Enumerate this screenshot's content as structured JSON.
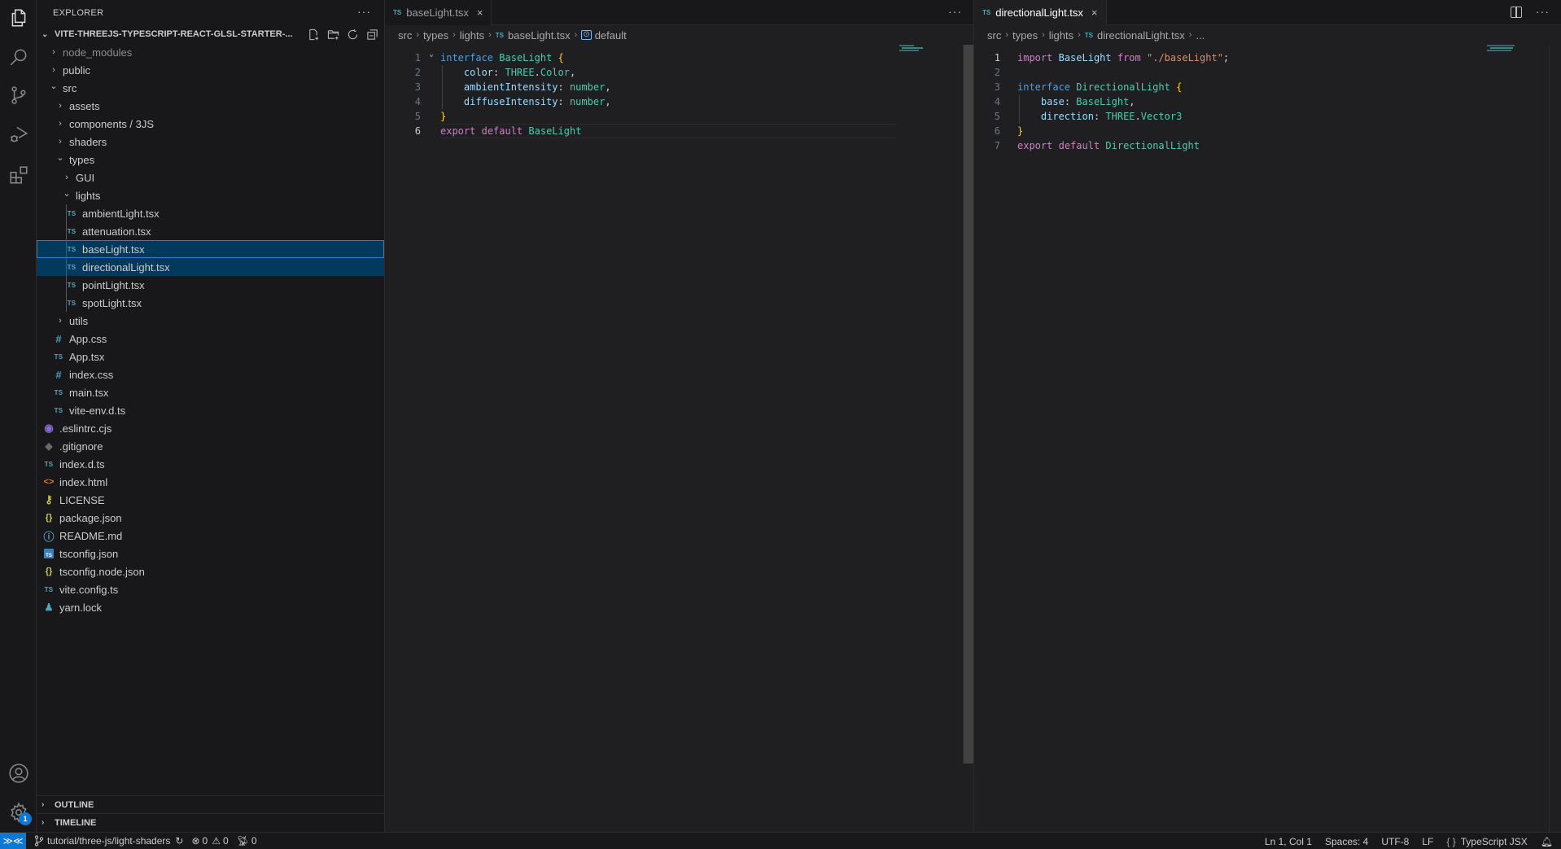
{
  "sidebar": {
    "title": "EXPLORER",
    "more_label": "···",
    "root": "VITE-THREEJS-TYPESCRIPT-REACT-GLSL-STARTER-...",
    "tree": [
      {
        "label": "node_modules",
        "type": "folder",
        "depth": 0,
        "expanded": false,
        "dim": true
      },
      {
        "label": "public",
        "type": "folder",
        "depth": 0,
        "expanded": false
      },
      {
        "label": "src",
        "type": "folder",
        "depth": 0,
        "expanded": true
      },
      {
        "label": "assets",
        "type": "folder",
        "depth": 1,
        "expanded": false
      },
      {
        "label": "components / 3JS",
        "type": "folder",
        "depth": 1,
        "expanded": false
      },
      {
        "label": "shaders",
        "type": "folder",
        "depth": 1,
        "expanded": false
      },
      {
        "label": "types",
        "type": "folder",
        "depth": 1,
        "expanded": true
      },
      {
        "label": "GUI",
        "type": "folder",
        "depth": 2,
        "expanded": false
      },
      {
        "label": "lights",
        "type": "folder",
        "depth": 2,
        "expanded": true
      },
      {
        "label": "ambientLight.tsx",
        "type": "ts",
        "depth": 3
      },
      {
        "label": "attenuation.tsx",
        "type": "ts",
        "depth": 3
      },
      {
        "label": "baseLight.tsx",
        "type": "ts",
        "depth": 3,
        "state": "focused"
      },
      {
        "label": "directionalLight.tsx",
        "type": "ts",
        "depth": 3,
        "state": "selected"
      },
      {
        "label": "pointLight.tsx",
        "type": "ts",
        "depth": 3
      },
      {
        "label": "spotLight.tsx",
        "type": "ts",
        "depth": 3
      },
      {
        "label": "utils",
        "type": "folder",
        "depth": 1,
        "expanded": false
      },
      {
        "label": "App.css",
        "type": "css",
        "depth": 1
      },
      {
        "label": "App.tsx",
        "type": "ts",
        "depth": 1
      },
      {
        "label": "index.css",
        "type": "css",
        "depth": 1
      },
      {
        "label": "main.tsx",
        "type": "ts",
        "depth": 1
      },
      {
        "label": "vite-env.d.ts",
        "type": "ts",
        "depth": 1
      },
      {
        "label": ".eslintrc.cjs",
        "type": "eslint",
        "depth": 0
      },
      {
        "label": ".gitignore",
        "type": "git",
        "depth": 0
      },
      {
        "label": "index.d.ts",
        "type": "ts",
        "depth": 0
      },
      {
        "label": "index.html",
        "type": "html",
        "depth": 0
      },
      {
        "label": "LICENSE",
        "type": "license",
        "depth": 0
      },
      {
        "label": "package.json",
        "type": "json",
        "depth": 0
      },
      {
        "label": "README.md",
        "type": "info",
        "depth": 0
      },
      {
        "label": "tsconfig.json",
        "type": "tsconfig",
        "depth": 0
      },
      {
        "label": "tsconfig.node.json",
        "type": "json",
        "depth": 0
      },
      {
        "label": "vite.config.ts",
        "type": "ts",
        "depth": 0
      },
      {
        "label": "yarn.lock",
        "type": "yarn",
        "depth": 0
      }
    ],
    "outline_label": "OUTLINE",
    "timeline_label": "TIMELINE"
  },
  "activity_bar": {
    "items": [
      "explorer-icon",
      "search-icon",
      "source-control-icon",
      "run-debug-icon",
      "extensions-icon"
    ],
    "bottom": [
      "account-icon",
      "settings-gear-icon"
    ],
    "settings_badge": "1"
  },
  "editors": [
    {
      "tab": {
        "icon": "TS",
        "label": "baseLight.tsx",
        "close": "×",
        "active": false
      },
      "breadcrumb": [
        "src",
        "types",
        "lights",
        "baseLight.tsx",
        "default"
      ],
      "more_label": "···",
      "current_line": 6,
      "lines": [
        {
          "n": "1",
          "fold": true,
          "tokens": [
            [
              "k",
              "interface"
            ],
            [
              "w",
              " "
            ],
            [
              "t",
              "BaseLight"
            ],
            [
              "w",
              " "
            ],
            [
              "b",
              "{"
            ]
          ]
        },
        {
          "n": "2",
          "tokens": [
            [
              "w",
              "    "
            ],
            [
              "p",
              "color"
            ],
            [
              "w",
              ": "
            ],
            [
              "t",
              "THREE"
            ],
            [
              "w",
              "."
            ],
            [
              "t",
              "Color"
            ],
            [
              "w",
              ","
            ]
          ]
        },
        {
          "n": "3",
          "tokens": [
            [
              "w",
              "    "
            ],
            [
              "p",
              "ambientIntensity"
            ],
            [
              "w",
              ": "
            ],
            [
              "t",
              "number"
            ],
            [
              "w",
              ","
            ]
          ]
        },
        {
          "n": "4",
          "tokens": [
            [
              "w",
              "    "
            ],
            [
              "p",
              "diffuseIntensity"
            ],
            [
              "w",
              ": "
            ],
            [
              "t",
              "number"
            ],
            [
              "w",
              ","
            ]
          ]
        },
        {
          "n": "5",
          "tokens": [
            [
              "b",
              "}"
            ]
          ]
        },
        {
          "n": "6",
          "tokens": [
            [
              "k2",
              "export"
            ],
            [
              "w",
              " "
            ],
            [
              "k2",
              "default"
            ],
            [
              "w",
              " "
            ],
            [
              "t",
              "BaseLight"
            ]
          ]
        }
      ]
    },
    {
      "tab": {
        "icon": "TS",
        "label": "directionalLight.tsx",
        "close": "×",
        "active": true
      },
      "breadcrumb": [
        "src",
        "types",
        "lights",
        "directionalLight.tsx",
        "..."
      ],
      "more_label": "···",
      "current_line": 1,
      "lines": [
        {
          "n": "1",
          "tokens": [
            [
              "k2",
              "import"
            ],
            [
              "w",
              " "
            ],
            [
              "p",
              "BaseLight"
            ],
            [
              "w",
              " "
            ],
            [
              "k2",
              "from"
            ],
            [
              "w",
              " "
            ],
            [
              "s",
              "\"./baseLight\""
            ],
            [
              "w",
              ";"
            ]
          ]
        },
        {
          "n": "2",
          "tokens": []
        },
        {
          "n": "3",
          "tokens": [
            [
              "k",
              "interface"
            ],
            [
              "w",
              " "
            ],
            [
              "t",
              "DirectionalLight"
            ],
            [
              "w",
              " "
            ],
            [
              "b",
              "{"
            ]
          ]
        },
        {
          "n": "4",
          "tokens": [
            [
              "w",
              "    "
            ],
            [
              "p",
              "base"
            ],
            [
              "w",
              ": "
            ],
            [
              "t",
              "BaseLight"
            ],
            [
              "w",
              ","
            ]
          ]
        },
        {
          "n": "5",
          "tokens": [
            [
              "w",
              "    "
            ],
            [
              "p",
              "direction"
            ],
            [
              "w",
              ": "
            ],
            [
              "t",
              "THREE"
            ],
            [
              "w",
              "."
            ],
            [
              "t",
              "Vector3"
            ]
          ]
        },
        {
          "n": "6",
          "tokens": [
            [
              "b",
              "}"
            ]
          ]
        },
        {
          "n": "7",
          "tokens": [
            [
              "k2",
              "export"
            ],
            [
              "w",
              " "
            ],
            [
              "k2",
              "default"
            ],
            [
              "w",
              " "
            ],
            [
              "t",
              "DirectionalLight"
            ]
          ]
        }
      ]
    }
  ],
  "statusbar": {
    "branch": "tutorial/three-js/light-shaders",
    "errors": "0",
    "warnings": "0",
    "ports": "0",
    "position": "Ln 1, Col 1",
    "indent": "Spaces: 4",
    "encoding": "UTF-8",
    "eol": "LF",
    "language": "TypeScript JSX",
    "colors": {
      "remote": "#0a78d4",
      "selection": "#04395e",
      "focus_border": "#2a7bd4"
    }
  }
}
